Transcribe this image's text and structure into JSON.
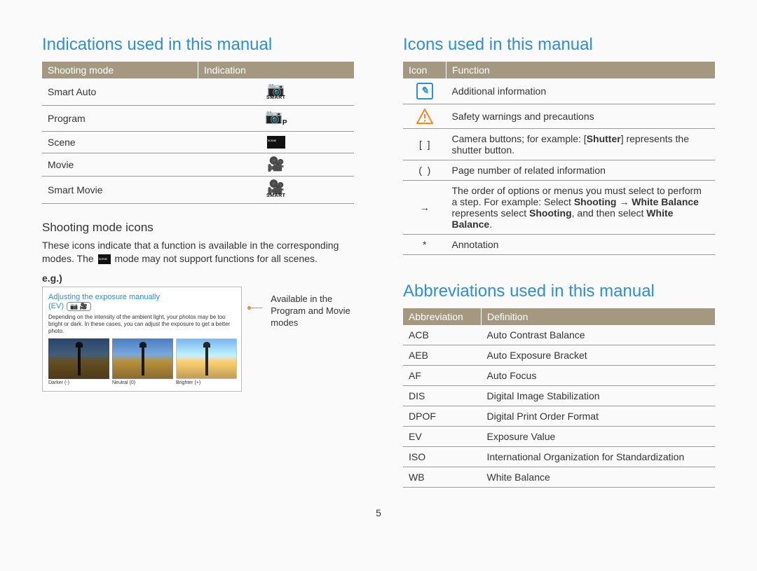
{
  "page_number": "5",
  "left": {
    "heading": "Indications used in this manual",
    "table_headers": [
      "Shooting mode",
      "Indication"
    ],
    "modes": [
      {
        "name": "Smart Auto",
        "icon": "camera-smart"
      },
      {
        "name": "Program",
        "icon": "camera-p"
      },
      {
        "name": "Scene",
        "icon": "scene"
      },
      {
        "name": "Movie",
        "icon": "movie"
      },
      {
        "name": "Smart Movie",
        "icon": "movie-smart"
      }
    ],
    "sub_heading": "Shooting mode icons",
    "sub_body_pre": "These icons indicate that a function is available in the corresponding modes. The ",
    "sub_body_post": " mode may not support functions for all scenes.",
    "eg_label": "e.g.)",
    "example": {
      "title": "Adjusting the exposure manually",
      "ev_label": "(EV)",
      "pill_icons": "📷 🎥",
      "desc": "Depending on the intensity of the ambient light, your photos may be too bright or dark. In these cases, you can adjust the exposure to get a better photo.",
      "thumbs": [
        "Darker (-)",
        "Neutral (0)",
        "Brighter (+)"
      ],
      "caption": "Available in the Program and Movie modes"
    }
  },
  "right_icons": {
    "heading": "Icons used in this manual",
    "table_headers": [
      "Icon",
      "Function"
    ],
    "rows": [
      {
        "icon": "info-box",
        "text": "Additional information"
      },
      {
        "icon": "warn-tri",
        "text": "Safety warnings and precautions"
      },
      {
        "icon": "brackets",
        "text_pre": "Camera buttons; for example: [",
        "bold": "Shutter",
        "text_post": "] represents the shutter button."
      },
      {
        "icon": "parens",
        "text": "Page number of related information"
      },
      {
        "icon": "arrow",
        "text_pre": "The order of options or menus you must select to perform a step. For example: Select ",
        "bold1": "Shooting",
        "arrow": " → ",
        "bold2": "White Balance",
        "mid": " represents select ",
        "bold3": "Shooting",
        "post1": ", and then select ",
        "bold4": "White Balance",
        "post2": "."
      },
      {
        "icon": "star",
        "text": "Annotation"
      }
    ]
  },
  "right_abbr": {
    "heading": "Abbreviations used in this manual",
    "table_headers": [
      "Abbreviation",
      "Definition"
    ],
    "rows": [
      {
        "abbr": "ACB",
        "def": "Auto Contrast Balance"
      },
      {
        "abbr": "AEB",
        "def": "Auto Exposure Bracket"
      },
      {
        "abbr": "AF",
        "def": "Auto Focus"
      },
      {
        "abbr": "DIS",
        "def": "Digital Image Stabilization"
      },
      {
        "abbr": "DPOF",
        "def": "Digital Print Order Format"
      },
      {
        "abbr": "EV",
        "def": "Exposure Value"
      },
      {
        "abbr": "ISO",
        "def": "International Organization for Standardization"
      },
      {
        "abbr": "WB",
        "def": "White Balance"
      }
    ]
  }
}
